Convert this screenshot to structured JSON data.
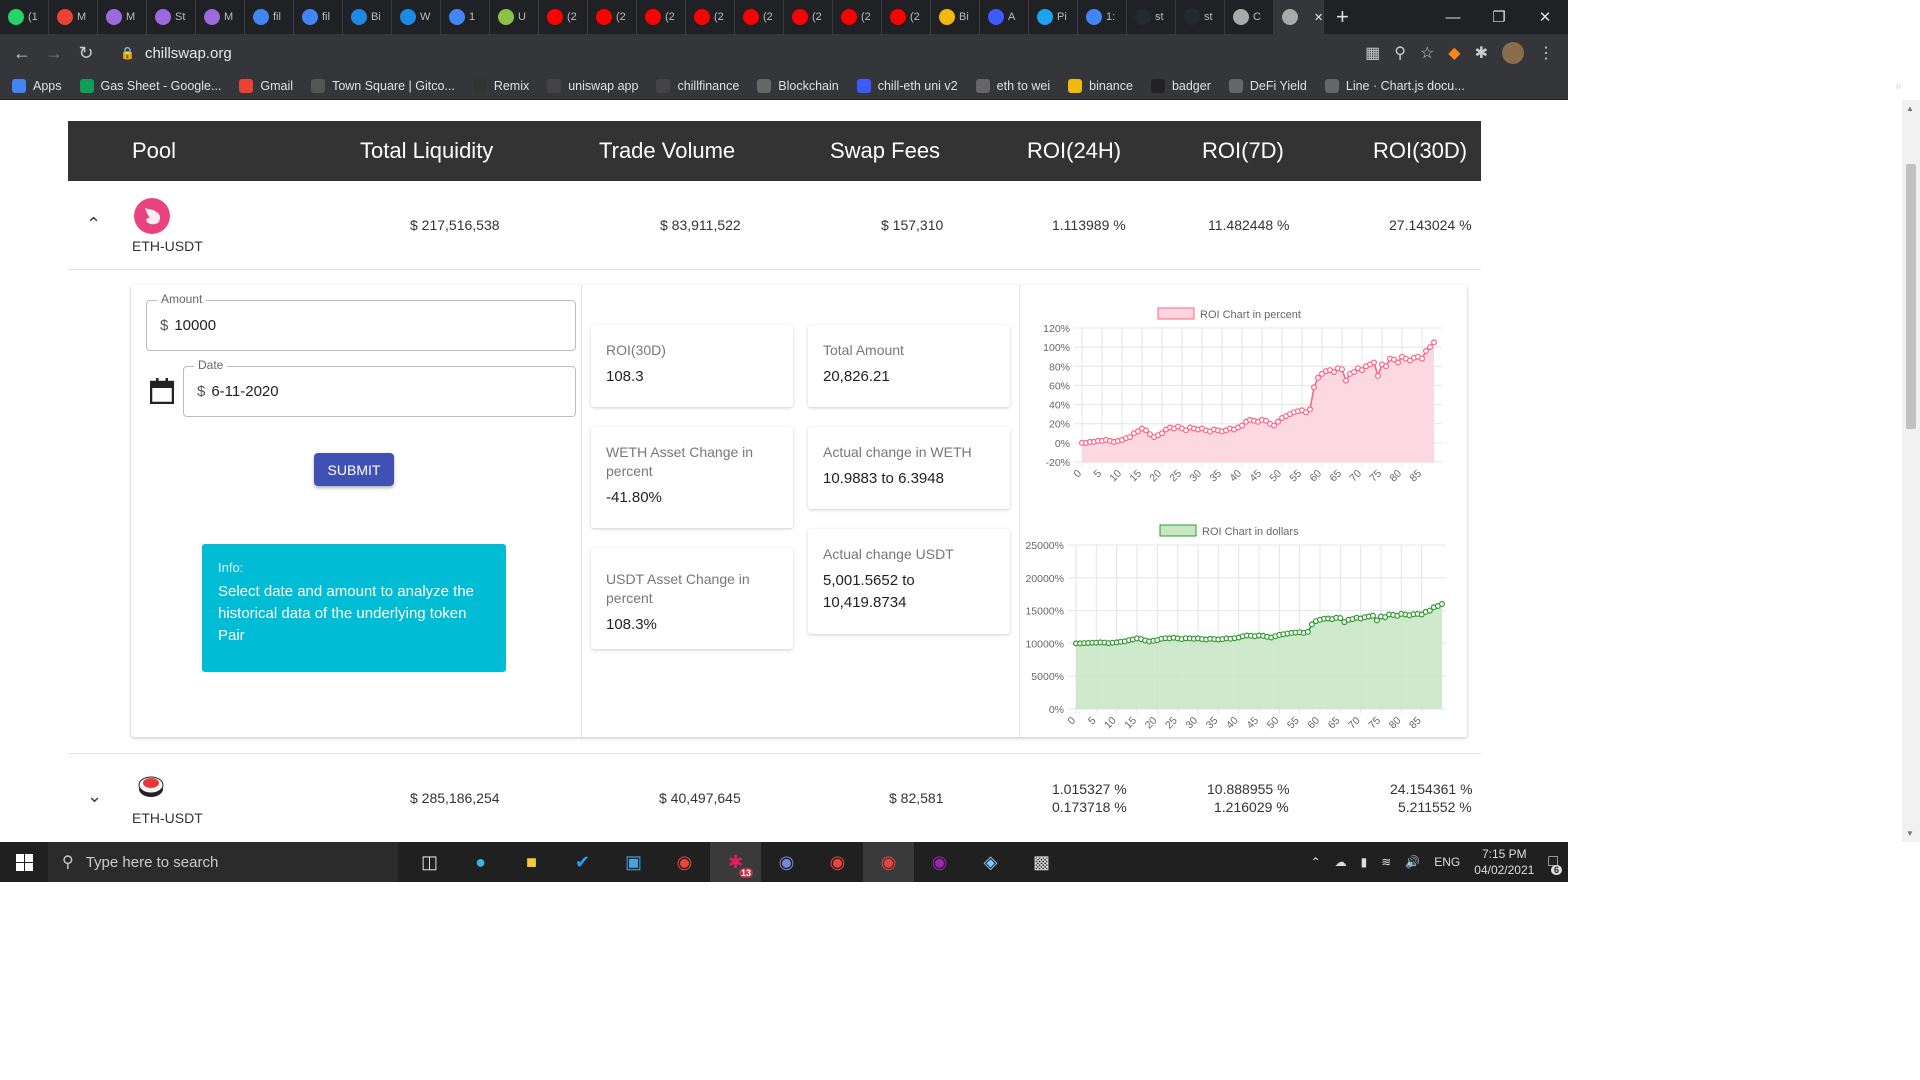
{
  "browser": {
    "tabs": [
      {
        "icon": "whatsapp-icon",
        "label": "(1",
        "color": "#25d366"
      },
      {
        "icon": "gmail-icon",
        "label": "M",
        "color": "#ea4335"
      },
      {
        "icon": "link-icon",
        "label": "M",
        "color": "#9c6ade"
      },
      {
        "icon": "link-icon",
        "label": "St",
        "color": "#9c6ade"
      },
      {
        "icon": "link-icon",
        "label": "M",
        "color": "#9c6ade"
      },
      {
        "icon": "google-icon",
        "label": "fil",
        "color": "#4285f4"
      },
      {
        "icon": "google-icon",
        "label": "fil",
        "color": "#4285f4"
      },
      {
        "icon": "bolt-icon",
        "label": "Bi",
        "color": "#1e88e5"
      },
      {
        "icon": "bolt-icon",
        "label": "W",
        "color": "#1e88e5"
      },
      {
        "icon": "google-icon",
        "label": "1",
        "color": "#4285f4"
      },
      {
        "icon": "smile-icon",
        "label": "U",
        "color": "#8bc34a"
      },
      {
        "icon": "youtube-icon",
        "label": "(2",
        "color": "#ff0000"
      },
      {
        "icon": "youtube-icon",
        "label": "(2",
        "color": "#ff0000"
      },
      {
        "icon": "youtube-icon",
        "label": "(2",
        "color": "#ff0000"
      },
      {
        "icon": "youtube-icon",
        "label": "(2",
        "color": "#ff0000"
      },
      {
        "icon": "youtube-icon",
        "label": "(2",
        "color": "#ff0000"
      },
      {
        "icon": "youtube-icon",
        "label": "(2",
        "color": "#ff0000"
      },
      {
        "icon": "youtube-icon",
        "label": "(2",
        "color": "#ff0000"
      },
      {
        "icon": "youtube-icon",
        "label": "(2",
        "color": "#ff0000"
      },
      {
        "icon": "binance-icon",
        "label": "Bi",
        "color": "#f0b90b"
      },
      {
        "icon": "moon-icon",
        "label": "A",
        "color": "#3d5afe"
      },
      {
        "icon": "twitter-icon",
        "label": "Pi",
        "color": "#1da1f2"
      },
      {
        "icon": "google-icon",
        "label": "1:",
        "color": "#4285f4"
      },
      {
        "icon": "github-icon",
        "label": "st",
        "color": "#24292e"
      },
      {
        "icon": "github-icon",
        "label": "st",
        "color": "#24292e"
      },
      {
        "icon": "chillswap-icon",
        "label": "C",
        "color": "#aaaaaa"
      },
      {
        "icon": "chillswap-icon",
        "label": "",
        "color": "#aaaaaa"
      }
    ],
    "url": "chillswap.org",
    "bookmarks": [
      {
        "label": "Apps",
        "color": "#4285f4"
      },
      {
        "label": "Gas Sheet - Google...",
        "color": "#0f9d58"
      },
      {
        "label": "Gmail",
        "color": "#ea4335"
      },
      {
        "label": "Town Square | Gitco...",
        "color": "#555555"
      },
      {
        "label": "Remix",
        "color": "#333333"
      },
      {
        "label": "uniswap app",
        "color": "#444444"
      },
      {
        "label": "chillfinance",
        "color": "#444444"
      },
      {
        "label": "Blockchain",
        "color": "#666666"
      },
      {
        "label": "chill-eth uni v2",
        "color": "#3d5afe"
      },
      {
        "label": "eth to wei",
        "color": "#666666"
      },
      {
        "label": "binance",
        "color": "#f0b90b"
      },
      {
        "label": "badger",
        "color": "#222222"
      },
      {
        "label": "DeFi Yield",
        "color": "#666666"
      },
      {
        "label": "Line · Chart.js docu...",
        "color": "#666666"
      }
    ],
    "more": "»"
  },
  "table": {
    "headers": {
      "pool": "Pool",
      "liquidity": "Total Liquidity",
      "volume": "Trade Volume",
      "fees": "Swap Fees",
      "roi24": "ROI(24H)",
      "roi7": "ROI(7D)",
      "roi30": "ROI(30D)"
    },
    "rows": [
      {
        "pair": "ETH-USDT",
        "liquidity": "$ 217,516,538",
        "volume": "$ 83,911,522",
        "fees": "$ 157,310",
        "roi24": "1.113989 %",
        "roi7": "11.482448 %",
        "roi30": "27.143024 %"
      },
      {
        "pair": "ETH-USDT",
        "liquidity": "$ 285,186,254",
        "volume": "$ 40,497,645",
        "fees": "$ 82,581",
        "roi24": "1.015327 %",
        "roi24b": "0.173718 %",
        "roi7": "10.888955 %",
        "roi7b": "1.216029 %",
        "roi30": "24.154361 %",
        "roi30b": "5.211552 %"
      }
    ]
  },
  "form": {
    "amount_label": "Amount",
    "amount_currency": "$",
    "amount_value": "10000",
    "date_label": "Date",
    "date_currency": "$",
    "date_value": "6-11-2020",
    "submit_label": "SUBMIT"
  },
  "info": {
    "title": "Info:",
    "text": "Select date and amount to analyze the historical data of the underlying token Pair"
  },
  "cards": {
    "roi30_title": "ROI(30D)",
    "roi30_value": "108.3",
    "total_title": "Total Amount",
    "total_value": "20,826.21",
    "weth_pct_title": "WETH Asset Change in percent",
    "weth_pct_value": "-41.80%",
    "weth_actual_title": "Actual change in WETH",
    "weth_actual_value": "10.9883 to 6.3948",
    "usdt_pct_title": "USDT Asset Change in percent",
    "usdt_pct_value": "108.3%",
    "usdt_actual_title": "Actual change USDT",
    "usdt_actual_value": "5,001.5652 to 10,419.8734"
  },
  "chart_data": [
    {
      "type": "line",
      "title": "",
      "legend": "ROI Chart in percent",
      "legend_position": "top",
      "color": "#ff6384",
      "fill": "#fcd5df",
      "ylim": [
        -20,
        120
      ],
      "yticks": [
        "120%",
        "100%",
        "80%",
        "60%",
        "40%",
        "20%",
        "0%",
        "-20%"
      ],
      "xticks": [
        "0",
        "5",
        "10",
        "15",
        "20",
        "25",
        "30",
        "35",
        "40",
        "45",
        "50",
        "55",
        "60",
        "65",
        "70",
        "75",
        "80",
        "85"
      ],
      "x_count": 90,
      "values": [
        0,
        0,
        1,
        1,
        2,
        2,
        3,
        2,
        1,
        2,
        3,
        5,
        6,
        10,
        12,
        15,
        13,
        9,
        6,
        8,
        10,
        14,
        16,
        15,
        17,
        15,
        13,
        16,
        15,
        14,
        15,
        13,
        12,
        14,
        13,
        12,
        13,
        15,
        14,
        16,
        18,
        22,
        24,
        23,
        22,
        24,
        23,
        20,
        18,
        22,
        26,
        28,
        30,
        32,
        33,
        34,
        32,
        35,
        58,
        68,
        72,
        75,
        76,
        74,
        78,
        77,
        65,
        72,
        74,
        78,
        76,
        80,
        82,
        84,
        70,
        82,
        80,
        88,
        87,
        84,
        90,
        88,
        86,
        89,
        90,
        88,
        96,
        100,
        105
      ],
      "grid": true
    },
    {
      "type": "line",
      "title": "",
      "legend": "ROI Chart in dollars",
      "legend_position": "top",
      "color": "#2e9a2e",
      "fill": "#c9e7c5",
      "ylim": [
        0,
        25000
      ],
      "yticks": [
        "25000%",
        "20000%",
        "15000%",
        "10000%",
        "5000%",
        "0%"
      ],
      "xticks": [
        "0",
        "5",
        "10",
        "15",
        "20",
        "25",
        "30",
        "35",
        "40",
        "45",
        "50",
        "55",
        "60",
        "65",
        "70",
        "75",
        "80",
        "85"
      ],
      "x_count": 91,
      "values": [
        10000,
        10000,
        10050,
        10060,
        10100,
        10100,
        10150,
        10120,
        10050,
        10100,
        10160,
        10260,
        10310,
        10500,
        10600,
        10760,
        10650,
        10450,
        10300,
        10400,
        10500,
        10700,
        10800,
        10760,
        10850,
        10760,
        10650,
        10800,
        10760,
        10700,
        10760,
        10650,
        10600,
        10700,
        10650,
        10600,
        10650,
        10760,
        10700,
        10800,
        10900,
        11100,
        11200,
        11160,
        11100,
        11200,
        11160,
        11000,
        10900,
        11100,
        11300,
        11400,
        11500,
        11600,
        11650,
        11700,
        11600,
        11760,
        12900,
        13400,
        13600,
        13760,
        13800,
        13700,
        13900,
        13850,
        13250,
        13600,
        13700,
        13900,
        13800,
        14000,
        14100,
        14200,
        13500,
        14100,
        14000,
        14400,
        14350,
        14200,
        14500,
        14400,
        14300,
        14450,
        14500,
        14400,
        14800,
        15000,
        15500,
        15700,
        16000
      ],
      "grid": true
    }
  ],
  "taskbar": {
    "search_placeholder": "Type here to search",
    "language": "ENG",
    "time": "7:15 PM",
    "date": "04/02/2021",
    "notifications": "6",
    "badge": "13"
  }
}
